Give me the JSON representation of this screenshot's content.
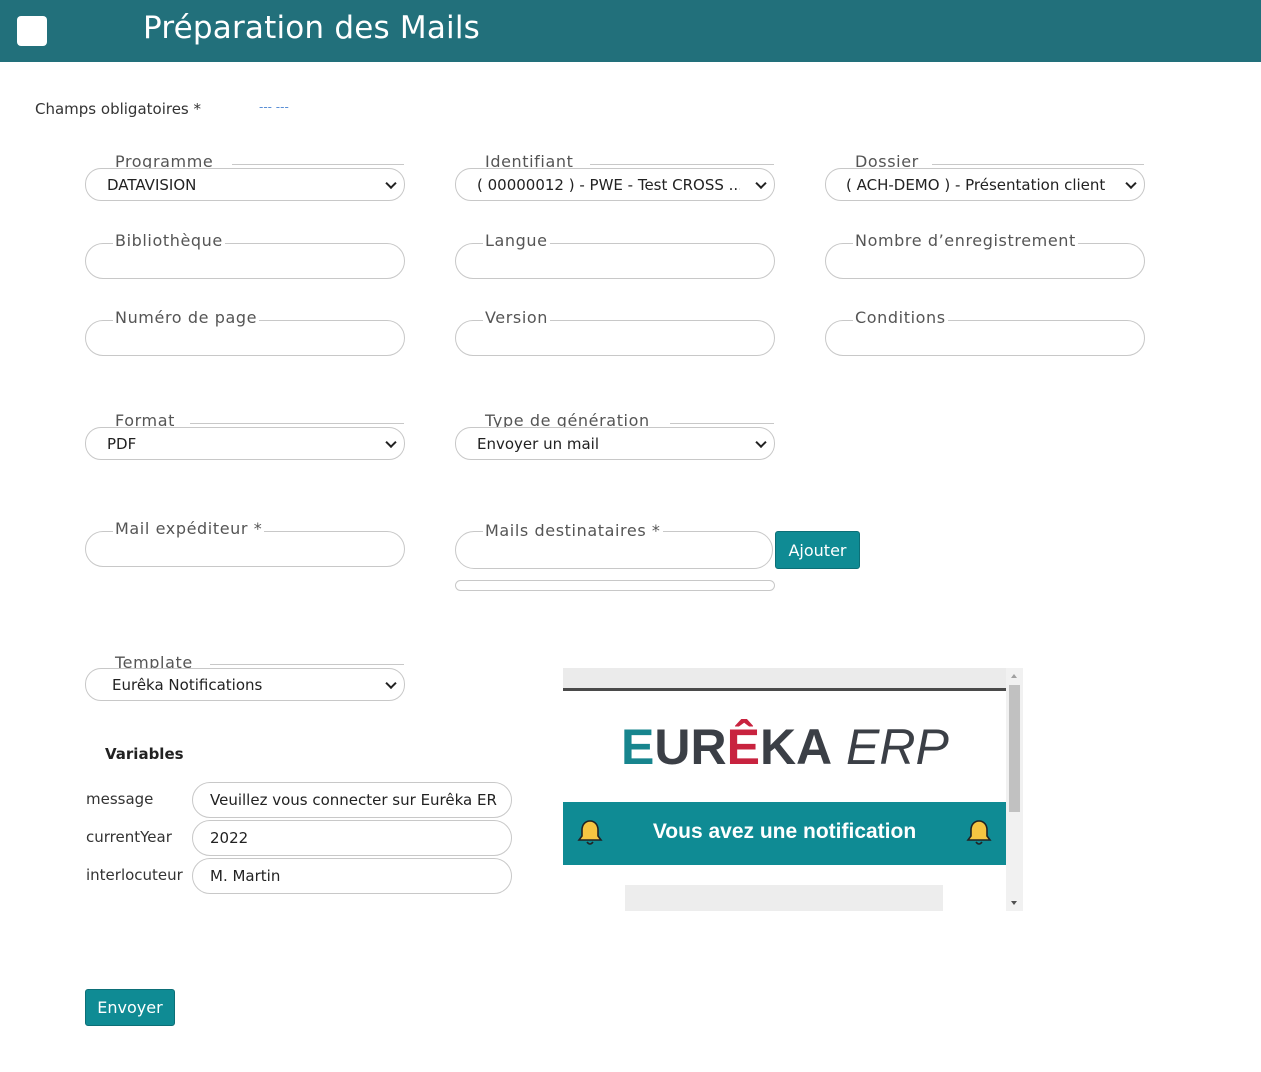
{
  "header": {
    "title": "Préparation des Mails"
  },
  "required_note": {
    "label": "Champs obligatoires *",
    "link": "--- ---"
  },
  "fields": {
    "programme": {
      "label": "Programme",
      "value": "DATAVISION"
    },
    "identifiant": {
      "label": "Identifiant",
      "value": "( 00000012 ) - PWE - Test CROSS ..."
    },
    "dossier": {
      "label": "Dossier",
      "value": "( ACH-DEMO ) - Présentation client"
    },
    "bibliotheque": {
      "label": "Bibliothèque",
      "value": ""
    },
    "langue": {
      "label": "Langue",
      "value": ""
    },
    "nombre_enregistrement": {
      "label": "Nombre d’enregistrement",
      "value": ""
    },
    "numero_page": {
      "label": "Numéro de page",
      "value": ""
    },
    "version": {
      "label": "Version",
      "value": ""
    },
    "conditions": {
      "label": "Conditions",
      "value": ""
    },
    "format": {
      "label": "Format",
      "value": "PDF"
    },
    "type_generation": {
      "label": "Type de génération",
      "value": "Envoyer un mail"
    },
    "mail_expediteur": {
      "label": "Mail expéditeur *",
      "value": ""
    },
    "mails_destinataires": {
      "label": "Mails destinataires *",
      "value": ""
    },
    "template": {
      "label": "Template",
      "value": "Eurêka Notifications"
    }
  },
  "buttons": {
    "ajouter": "Ajouter",
    "envoyer": "Envoyer"
  },
  "variables": {
    "title": "Variables",
    "items": [
      {
        "name": "message",
        "value": "Veuillez vous connecter sur Eurêka ERP"
      },
      {
        "name": "currentYear",
        "value": "2022"
      },
      {
        "name": "interlocuteur",
        "value": "M. Martin"
      }
    ]
  },
  "preview": {
    "logo": {
      "e": "E",
      "ur": "UR",
      "e_hat": "Ê",
      "ka": "KA",
      "erp": " ERP"
    },
    "notification": "Vous avez une notification"
  },
  "colors": {
    "header": "#22707b",
    "accent": "#0f8b94",
    "logo_teal": "#17858e",
    "logo_red": "#c8233f"
  }
}
